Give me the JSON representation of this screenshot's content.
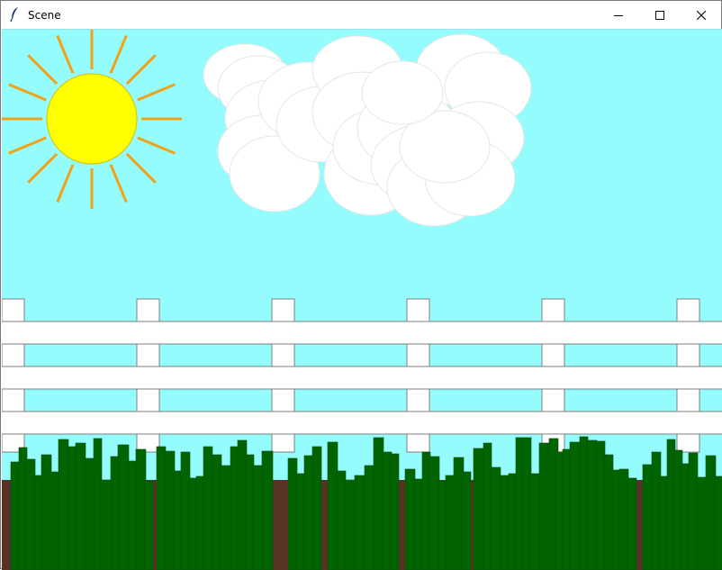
{
  "window": {
    "title": "Scene",
    "icons": {
      "app": "feather-icon",
      "minimize": "minimize-icon",
      "maximize": "maximize-icon",
      "close": "close-icon"
    }
  },
  "scene": {
    "colors": {
      "sky": "#94fcfc",
      "sun": "#ffff00",
      "sun_outline": "#d8c000",
      "rays": "#f2a11a",
      "cloud": "#ffffff",
      "cloud_outline": "#e6e6e6",
      "fence": "#ffffff",
      "fence_outline": "#7f7f7f",
      "soil": "#583323",
      "grass": "#006400",
      "grass_outline": "#0d4d0d"
    }
  }
}
